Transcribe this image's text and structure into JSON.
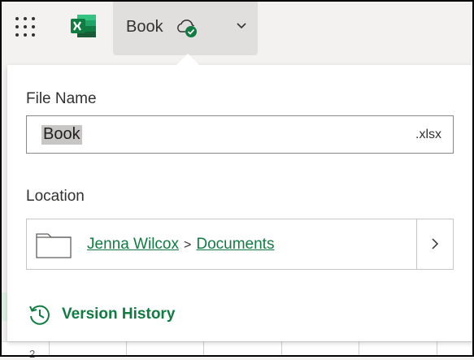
{
  "header": {
    "app_icon": "excel-icon",
    "document_title": "Book",
    "sync_status_icon": "cloud-check-icon",
    "dropdown_icon": "chevron-down-icon"
  },
  "file_panel": {
    "file_name_label": "File Name",
    "file_name_value": "Book",
    "file_extension": ".xlsx",
    "location_label": "Location",
    "location_path": [
      "Jenna Wilcox",
      "Documents"
    ],
    "location_separator": ">",
    "version_history_label": "Version History"
  },
  "sheet": {
    "visible_row_number": "2"
  },
  "colors": {
    "accent": "#107c41",
    "panel_bg": "#ffffff",
    "chrome_bg": "#f3f2f1"
  }
}
